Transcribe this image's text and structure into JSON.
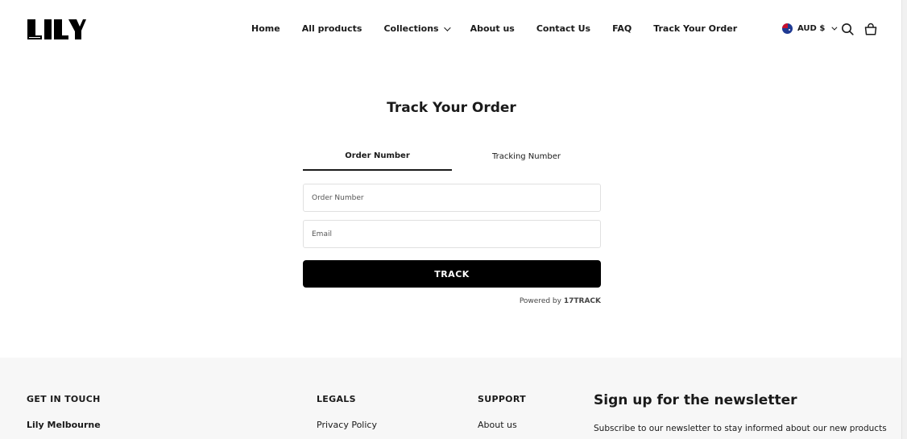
{
  "header": {
    "logo_alt": "LILY",
    "nav": [
      {
        "label": "Home"
      },
      {
        "label": "All products"
      },
      {
        "label": "Collections"
      },
      {
        "label": "About us"
      },
      {
        "label": "Contact Us"
      },
      {
        "label": "FAQ"
      },
      {
        "label": "Track Your Order"
      }
    ],
    "currency": "AUD $"
  },
  "main": {
    "title": "Track Your Order",
    "tabs": [
      {
        "label": "Order Number",
        "active": true
      },
      {
        "label": "Tracking Number",
        "active": false
      }
    ],
    "order_number_placeholder": "Order Number",
    "email_placeholder": "Email",
    "track_button": "TRACK",
    "powered_by": "Powered by",
    "powered_brand": "17TRACK"
  },
  "footer": {
    "get_in_touch": {
      "heading": "GET IN TOUCH",
      "link": "Lily Melbourne"
    },
    "legals": {
      "heading": "LEGALS",
      "link": "Privacy Policy"
    },
    "support": {
      "heading": "SUPPORT",
      "link": "About us"
    },
    "newsletter": {
      "title": "Sign up for the newsletter",
      "text": "Subscribe to our newsletter to stay informed about our new products"
    }
  }
}
